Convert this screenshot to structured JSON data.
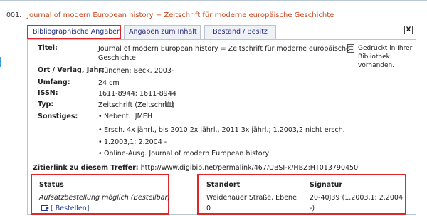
{
  "record": {
    "number": "001.",
    "title": "Journal of modern European history = Zeitschrift für moderne europäische Geschichte"
  },
  "tabs": [
    {
      "label": "Bibliographische Angaben",
      "active": true
    },
    {
      "label": "Angaben zum Inhalt",
      "active": false
    },
    {
      "label": "Bestand / Besitz",
      "active": false
    }
  ],
  "close_label": "X",
  "print_notice": "Gedruckt in Ihrer Bibliothek vorhanden.",
  "fields": {
    "titel": {
      "label": "Titel:",
      "line1": "Journal of modern European history = Zeitschrift für moderne europäische",
      "line2": "Geschichte"
    },
    "ort": {
      "label": "Ort / Verlag, Jahr:",
      "value": "München: Beck, 2003-"
    },
    "umfang": {
      "label": "Umfang:",
      "value": "24 cm"
    },
    "issn": {
      "label": "ISSN:",
      "value": "1611-8944; 1611-8944"
    },
    "typ": {
      "label": "Typ:",
      "value": "Zeitschrift (Zeitschrift)"
    },
    "sonstiges": {
      "label": "Sonstiges:",
      "items": [
        "Nebent.: JMEH",
        "Ersch. 4x jährl., bis 2010 2x jährl., 2011 3x jährl.; 1.2003,2 nicht ersch.",
        "1.2003,1; 2.2004 -",
        "Online-Ausg. Journal of modern European history"
      ]
    }
  },
  "cite": {
    "label": "Zitierlink zu diesem Treffer:",
    "url": "http://www.digibib.net/permalink/467/UBSI-x/HBZ:HT013790450"
  },
  "status": {
    "heading": "Status",
    "text": "Aufsatzbestellung möglich (Bestellbar)",
    "order_link": "[ Bestellen]"
  },
  "holdings": {
    "standort_heading": "Standort",
    "signatur_heading": "Signatur",
    "standort_line1": "Weidenauer Straße, Ebene",
    "standort_line2": "0",
    "signatur_line1": "20-40J39 (1.2003,1; 2.2004",
    "signatur_line2": "-)"
  },
  "colors": {
    "accent_red": "#e2242b",
    "title_orange": "#c8461e",
    "link_blue": "#1f3a9e"
  }
}
